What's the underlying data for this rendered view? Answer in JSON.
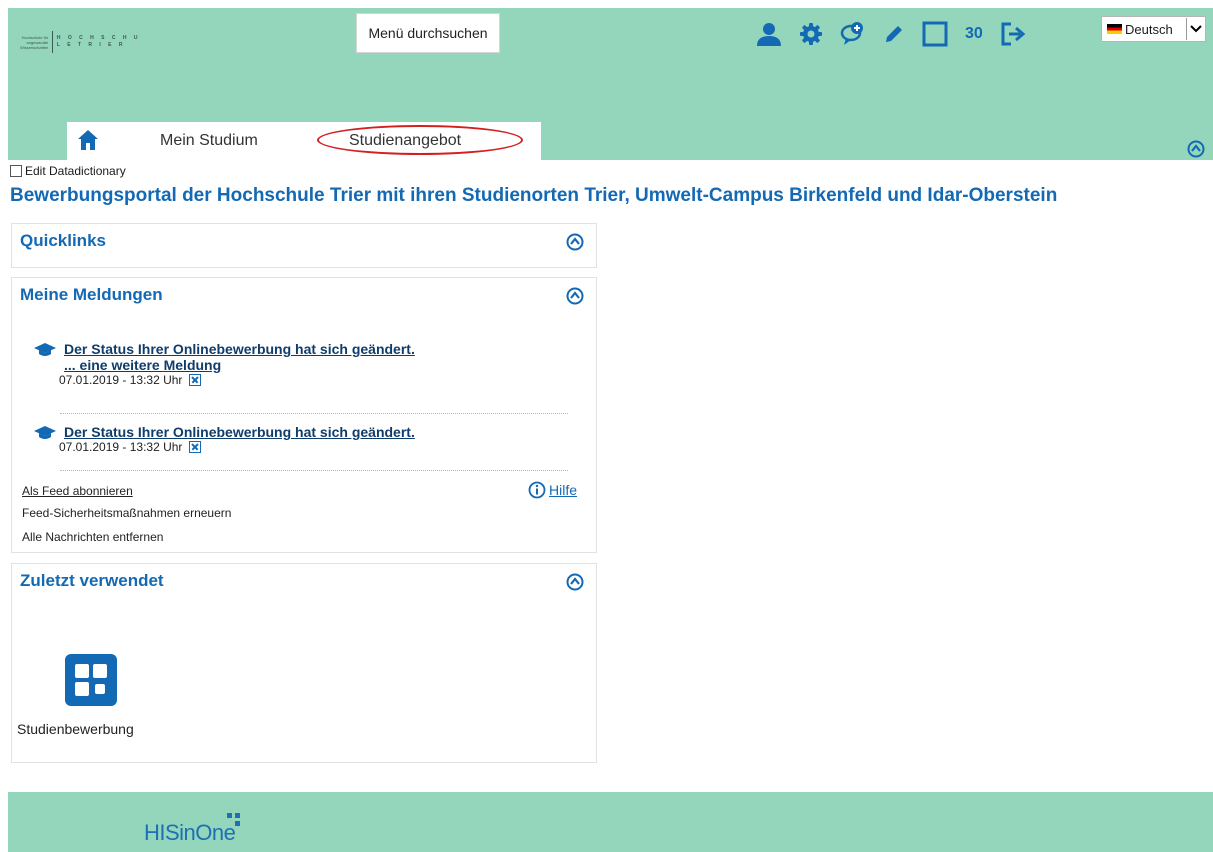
{
  "header": {
    "logo": {
      "small_text": "Hochschule für angewandte Wissenschaften",
      "big_text": "H O C H  S C H U L E  T R I E R"
    },
    "search_button": "Menü durchsuchen",
    "toolbar": {
      "icons": [
        "user-icon",
        "gear-icon",
        "chat-add-icon",
        "pencil-icon",
        "square-icon",
        "logout-icon"
      ],
      "session_count": "30"
    },
    "language": {
      "selected": "Deutsch"
    }
  },
  "nav": {
    "items": [
      {
        "label": "Mein Studium"
      },
      {
        "label": "Studienangebot"
      }
    ]
  },
  "edit_datadictionary_label": "Edit Datadictionary",
  "page_title": "Bewerbungsportal der Hochschule Trier mit ihren Studienorten Trier, Umwelt-Campus Birkenfeld und Idar-Oberstein",
  "panels": {
    "quicklinks": {
      "title": "Quicklinks"
    },
    "meldungen": {
      "title": "Meine Meldungen",
      "messages": [
        {
          "title": "Der Status Ihrer Onlinebewerbung hat sich geändert.",
          "more": "... eine weitere Meldung",
          "date": "07.01.2019 - 13:32 Uhr"
        },
        {
          "title": "Der Status Ihrer Onlinebewerbung hat sich geändert.",
          "date": "07.01.2019 - 13:32 Uhr"
        }
      ],
      "feed_subscribe": "Als Feed abonnieren",
      "help": "Hilfe",
      "feed_security": "Feed-Sicherheitsmaßnahmen erneuern",
      "remove_all": "Alle Nachrichten entfernen"
    },
    "zuletzt": {
      "title": "Zuletzt verwendet",
      "tile_label": "Studienbewerbung"
    }
  },
  "footer": {
    "brand": "HISinOne"
  },
  "colors": {
    "header_bg": "#93d6bb",
    "accent": "#1369b3",
    "highlight_oval": "#d41f1f"
  }
}
